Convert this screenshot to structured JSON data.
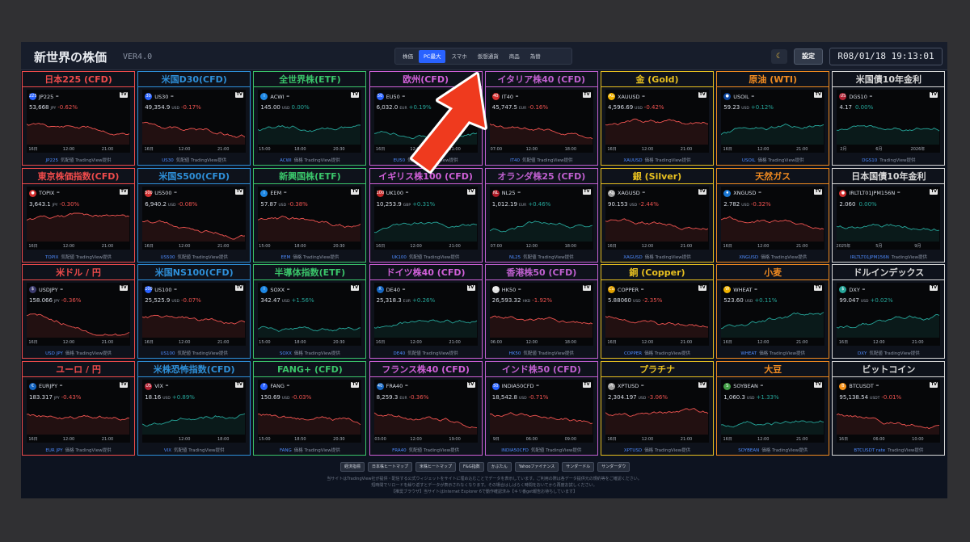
{
  "header": {
    "title": "新世界の株価",
    "version": "VER4.0",
    "settings_label": "設定",
    "clock": "R08/01/18 19:13:01",
    "theme_icon": "moon-icon"
  },
  "tabs": [
    {
      "label": "株価",
      "active": false
    },
    {
      "label": "PC最大",
      "active": true
    },
    {
      "label": "スマホ",
      "active": false
    },
    {
      "label": "仮想通貨",
      "active": false
    },
    {
      "label": "商品",
      "active": false
    },
    {
      "label": "為替",
      "active": false
    }
  ],
  "colors": {
    "up": "#26a69a",
    "down": "#ef5350",
    "accent": "#2962ff"
  },
  "cards": [
    {
      "title": "日本225 (CFD)",
      "color": "#ef4b4b",
      "symbol": "JP225",
      "icon_text": "225",
      "icon_color": "#2962ff",
      "price": "53,668",
      "currency": "JPY",
      "change": "-0.62%",
      "dir": "down",
      "ticks": [
        "16日",
        "12:00",
        "21:00"
      ],
      "footer_sym": "JP225",
      "footer_rest": "気配値 TradingView提供"
    },
    {
      "title": "米国D30(CFD)",
      "color": "#2e8fd8",
      "symbol": "US30",
      "icon_text": "30",
      "icon_color": "#2962ff",
      "price": "49,354.9",
      "currency": "USD",
      "change": "-0.17%",
      "dir": "down",
      "ticks": [
        "16日",
        "12:00",
        "21:00"
      ],
      "footer_sym": "US30",
      "footer_rest": "気配値 TradingView提供"
    },
    {
      "title": "全世界株(ETF)",
      "color": "#3ac46a",
      "symbol": "ACWI",
      "icon_text": "i",
      "icon_color": "#1e88e5",
      "price": "145.00",
      "currency": "USD",
      "change": "0.00%",
      "dir": "flat",
      "ticks": [
        "15:00",
        "18:00",
        "20:30"
      ],
      "footer_sym": "ACWI",
      "footer_rest": "価格 TradingView提供"
    },
    {
      "title": "欧州(CFD)",
      "color": "#d060d8",
      "symbol": "EU50",
      "icon_text": "50",
      "icon_color": "#2962ff",
      "price": "6,032.0",
      "currency": "EUR",
      "change": "+0.19%",
      "dir": "up",
      "ticks": [
        "16日",
        "12:00",
        "21:00"
      ],
      "footer_sym": "EU50",
      "footer_rest": "気配値 TradingView提供"
    },
    {
      "title": "イタリア株40 (CFD)",
      "color": "#c060d0",
      "symbol": "IT40",
      "icon_text": "40",
      "icon_color": "#d32f2f",
      "price": "45,747.5",
      "currency": "EUR",
      "change": "-0.16%",
      "dir": "down",
      "ticks": [
        "07:00",
        "12:00",
        "18:00"
      ],
      "footer_sym": "IT40",
      "footer_rest": "気配値 TradingView提供"
    },
    {
      "title": "金 (Gold)",
      "color": "#e8c020",
      "symbol": "XAUUSD",
      "icon_text": "Au",
      "icon_color": "#f2b400",
      "price": "4,596.69",
      "currency": "USD",
      "change": "-0.42%",
      "dir": "down",
      "ticks": [
        "16日",
        "12:00",
        "21:00"
      ],
      "footer_sym": "XAUUSD",
      "footer_rest": "価格 TradingView提供"
    },
    {
      "title": "原油 (WTI)",
      "color": "#f08a20",
      "symbol": "USOIL",
      "icon_text": "●",
      "icon_color": "#0d47a1",
      "price": "59.23",
      "currency": "USD",
      "change": "+0.12%",
      "dir": "up",
      "ticks": [
        "16日",
        "12:00",
        "21:00"
      ],
      "footer_sym": "USOIL",
      "footer_rest": "価格 TradingView提供"
    },
    {
      "title": "米国債10年金利",
      "color": "#d8d8d8",
      "symbol": "DGS10",
      "icon_text": "US",
      "icon_color": "#b22234",
      "price": "4.17",
      "currency": "",
      "change": "0.00%",
      "dir": "flat",
      "ticks": [
        "2月",
        "6月",
        "2026年"
      ],
      "footer_sym": "DGS10",
      "footer_rest": "TradingView提供"
    },
    {
      "title": "東京株価指数(CFD)",
      "color": "#ef4b4b",
      "symbol": "TOPIX",
      "icon_text": "●",
      "icon_color": "#d32f2f",
      "price": "3,643.1",
      "currency": "JPY",
      "change": "-0.30%",
      "dir": "down",
      "ticks": [
        "16日",
        "12:00",
        "21:00"
      ],
      "footer_sym": "TOPIX",
      "footer_rest": "気配値 TradingView提供"
    },
    {
      "title": "米国S500(CFD)",
      "color": "#2e8fd8",
      "symbol": "US500",
      "icon_text": "500",
      "icon_color": "#d32f2f",
      "price": "6,940.2",
      "currency": "USD",
      "change": "-0.08%",
      "dir": "down",
      "ticks": [
        "16日",
        "12:00",
        "21:00"
      ],
      "footer_sym": "US500",
      "footer_rest": "気配値 TradingView提供"
    },
    {
      "title": "新興国株(ETF)",
      "color": "#3ac46a",
      "symbol": "EEM",
      "icon_text": "i",
      "icon_color": "#1e88e5",
      "price": "57.87",
      "currency": "USD",
      "change": "-0.38%",
      "dir": "down",
      "ticks": [
        "15:00",
        "18:00",
        "20:30"
      ],
      "footer_sym": "EEM",
      "footer_rest": "価格 TradingView提供"
    },
    {
      "title": "イギリス株100 (CFD)",
      "color": "#d060d8",
      "symbol": "UK100",
      "icon_text": "100",
      "icon_color": "#c62828",
      "price": "10,253.9",
      "currency": "GBP",
      "change": "+0.31%",
      "dir": "up",
      "ticks": [
        "16日",
        "12:00",
        "21:00"
      ],
      "footer_sym": "UK100",
      "footer_rest": "気配値 TradingView提供"
    },
    {
      "title": "オランダ株25 (CFD)",
      "color": "#c060d0",
      "symbol": "NL25",
      "icon_text": "NL",
      "icon_color": "#ae1c28",
      "price": "1,012.19",
      "currency": "EUR",
      "change": "+0.46%",
      "dir": "up",
      "ticks": [
        "07:00",
        "12:00",
        "18:00"
      ],
      "footer_sym": "NL25",
      "footer_rest": "気配値 TradingView提供"
    },
    {
      "title": "銀 (Silver)",
      "color": "#e8c020",
      "symbol": "XAGUSD",
      "icon_text": "Ag",
      "icon_color": "#9e9e9e",
      "price": "90.153",
      "currency": "USD",
      "change": "-2.44%",
      "dir": "down",
      "ticks": [
        "16日",
        "12:00",
        "21:00"
      ],
      "footer_sym": "XAGUSD",
      "footer_rest": "価格 TradingView提供"
    },
    {
      "title": "天然ガス",
      "color": "#f08a20",
      "symbol": "XNGUSD",
      "icon_text": "♦",
      "icon_color": "#1976d2",
      "price": "2.782",
      "currency": "USD",
      "change": "-0.32%",
      "dir": "down",
      "ticks": [
        "16日",
        "12:00",
        "21:00"
      ],
      "footer_sym": "XNGUSD",
      "footer_rest": "価格 TradingView提供"
    },
    {
      "title": "日本国債10年金利",
      "color": "#d8d8d8",
      "symbol": "IRLTLT01JPM156N",
      "icon_text": "●",
      "icon_color": "#d32f2f",
      "price": "2.060",
      "currency": "",
      "change": "0.00%",
      "dir": "flat",
      "ticks": [
        "2025年",
        "5月",
        "9月"
      ],
      "footer_sym": "IRLTLT01JPM156N",
      "footer_rest": "TradingView提供"
    },
    {
      "title": "米ドル / 円",
      "color": "#ef4b4b",
      "symbol": "USDJPY",
      "icon_text": "$",
      "icon_color": "#3c3b6e",
      "price": "158.066",
      "currency": "JPY",
      "change": "-0.36%",
      "dir": "down",
      "ticks": [
        "16日",
        "12:00",
        "21:00"
      ],
      "footer_sym": "USD JPY",
      "footer_rest": "価格 TradingView提供"
    },
    {
      "title": "米国NS100(CFD)",
      "color": "#2e8fd8",
      "symbol": "US100",
      "icon_text": "100",
      "icon_color": "#2962ff",
      "price": "25,525.9",
      "currency": "USD",
      "change": "-0.07%",
      "dir": "down",
      "ticks": [
        "16日",
        "12:00",
        "21:00"
      ],
      "footer_sym": "US100",
      "footer_rest": "気配値 TradingView提供"
    },
    {
      "title": "半導体指数(ETF)",
      "color": "#3ac46a",
      "symbol": "SOXX",
      "icon_text": "i",
      "icon_color": "#1e88e5",
      "price": "342.47",
      "currency": "USD",
      "change": "+1.56%",
      "dir": "up",
      "ticks": [
        "15:00",
        "18:00",
        "20:30"
      ],
      "footer_sym": "SOXX",
      "footer_rest": "価格 TradingView提供"
    },
    {
      "title": "ドイツ株40 (CFD)",
      "color": "#d060d8",
      "symbol": "DE40",
      "icon_text": "X",
      "icon_color": "#1565c0",
      "price": "25,318.3",
      "currency": "EUR",
      "change": "+0.26%",
      "dir": "up",
      "ticks": [
        "16日",
        "12:00",
        "21:00"
      ],
      "footer_sym": "DE40",
      "footer_rest": "気配値 TradingView提供"
    },
    {
      "title": "香港株50 (CFD)",
      "color": "#c060d0",
      "symbol": "HK50",
      "icon_text": "HK",
      "icon_color": "#e0e0e0",
      "price": "26,593.32",
      "currency": "HKD",
      "change": "-1.92%",
      "dir": "down",
      "ticks": [
        "06:00",
        "12:00",
        "18:00"
      ],
      "footer_sym": "HK50",
      "footer_rest": "気配値 TradingView提供"
    },
    {
      "title": "銅 (Copper)",
      "color": "#e8c020",
      "symbol": "COPPER",
      "icon_text": "Cu",
      "icon_color": "#e0a000",
      "price": "5.88060",
      "currency": "USD",
      "change": "-2.35%",
      "dir": "down",
      "ticks": [
        "16日",
        "12:00",
        "21:00"
      ],
      "footer_sym": "COPPER",
      "footer_rest": "価格 TradingView提供"
    },
    {
      "title": "小麦",
      "color": "#f08a20",
      "symbol": "WHEAT",
      "icon_text": "W",
      "icon_color": "#f2b400",
      "price": "523.60",
      "currency": "USD",
      "change": "+0.11%",
      "dir": "up",
      "ticks": [
        "16日",
        "12:00",
        "21:00"
      ],
      "footer_sym": "WHEAT",
      "footer_rest": "価格 TradingView提供"
    },
    {
      "title": "ドルインデックス",
      "color": "#d8d8d8",
      "symbol": "DXY",
      "icon_text": "$",
      "icon_color": "#26a69a",
      "price": "99.047",
      "currency": "USD",
      "change": "+0.02%",
      "dir": "up",
      "ticks": [
        "16日",
        "12:00",
        "21:00"
      ],
      "footer_sym": "DXY",
      "footer_rest": "気配値 TradingView提供"
    },
    {
      "title": "ユーロ / 円",
      "color": "#ef4b4b",
      "symbol": "EURJPY",
      "icon_text": "€",
      "icon_color": "#1565c0",
      "price": "183.317",
      "currency": "JPY",
      "change": "-0.43%",
      "dir": "down",
      "ticks": [
        "16日",
        "12:00",
        "21:00"
      ],
      "footer_sym": "EUR JPY",
      "footer_rest": "価格 TradingView提供"
    },
    {
      "title": "米株恐怖指数(CFD)",
      "color": "#2e8fd8",
      "symbol": "VIX",
      "icon_text": "US",
      "icon_color": "#b22234",
      "price": "18.16",
      "currency": "USD",
      "change": "+0.89%",
      "dir": "up",
      "ticks": [
        "12:00",
        "18:00"
      ],
      "footer_sym": "VIX",
      "footer_rest": "気配値 TradingView提供"
    },
    {
      "title": "FANG+ (CFD)",
      "color": "#3ac46a",
      "symbol": "FANG",
      "icon_text": "F",
      "icon_color": "#2962ff",
      "price": "150.69",
      "currency": "USD",
      "change": "-0.03%",
      "dir": "down",
      "ticks": [
        "15:00",
        "18:50",
        "20:30"
      ],
      "footer_sym": "FANG",
      "footer_rest": "価格 TradingView提供"
    },
    {
      "title": "フランス株40 (CFD)",
      "color": "#d060d8",
      "symbol": "FRA40",
      "icon_text": "40",
      "icon_color": "#1565c0",
      "price": "8,259.3",
      "currency": "EUR",
      "change": "-0.36%",
      "dir": "down",
      "ticks": [
        "03:00",
        "12:00",
        "19:00"
      ],
      "footer_sym": "FRA40",
      "footer_rest": "気配値 TradingView提供"
    },
    {
      "title": "インド株50 (CFD)",
      "color": "#c060d0",
      "symbol": "INDIA50CFD",
      "icon_text": "50",
      "icon_color": "#2962ff",
      "price": "18,542.8",
      "currency": "USD",
      "change": "-0.71%",
      "dir": "down",
      "ticks": [
        "9日",
        "06:00",
        "09:00"
      ],
      "footer_sym": "INDIA50CFD",
      "footer_rest": "気配値 TradingView提供"
    },
    {
      "title": "プラチナ",
      "color": "#e8c020",
      "symbol": "XPTUSD",
      "icon_text": "Pt",
      "icon_color": "#9e9e9e",
      "price": "2,304.197",
      "currency": "USD",
      "change": "-3.06%",
      "dir": "down",
      "ticks": [
        "16日",
        "12:00",
        "21:00"
      ],
      "footer_sym": "XPTUSD",
      "footer_rest": "価格 TradingView提供"
    },
    {
      "title": "大豆",
      "color": "#f08a20",
      "symbol": "SOYBEAN",
      "icon_text": "S",
      "icon_color": "#43a047",
      "price": "1,060.3",
      "currency": "USD",
      "change": "+1.33%",
      "dir": "up",
      "ticks": [
        "16日",
        "12:00",
        "21:00"
      ],
      "footer_sym": "SOYBEAN",
      "footer_rest": "価格 TradingView提供"
    },
    {
      "title": "ビットコイン",
      "color": "#d8d8d8",
      "symbol": "BTCUSDT",
      "icon_text": "B",
      "icon_color": "#f7931a",
      "price": "95,138.54",
      "currency": "USDT",
      "change": "-0.01%",
      "dir": "down",
      "ticks": [
        "16日",
        "06:00",
        "10:00"
      ],
      "footer_sym": "BTCUSDT rate",
      "footer_rest": "TradingView提供"
    }
  ],
  "links": [
    "経済指標",
    "日本株ヒートマップ",
    "米株ヒートマップ",
    "F&G指数",
    "かぶたん",
    "Yahooファイナンス",
    "サンダードル",
    "サンダーダウ"
  ],
  "footnote": [
    "当サイトはTradingView社が提供・配信する公式ウィジェットをサイトに埋め込むことでデータを表示しています。ご利用の際は各データ提供元の規約等をご確認ください。",
    "短時間でリロードを繰り返すとデータが表示されなくなります。その場合はしばらく時間をおいてから再度お試しください。",
    "【推奨ブラウザ】当サイトはInternet Explorer 6で動作確認済み【キリ番get報告お待ちしています】"
  ],
  "annotation": {
    "type": "red-arrow",
    "target": "tab-pc-max"
  }
}
